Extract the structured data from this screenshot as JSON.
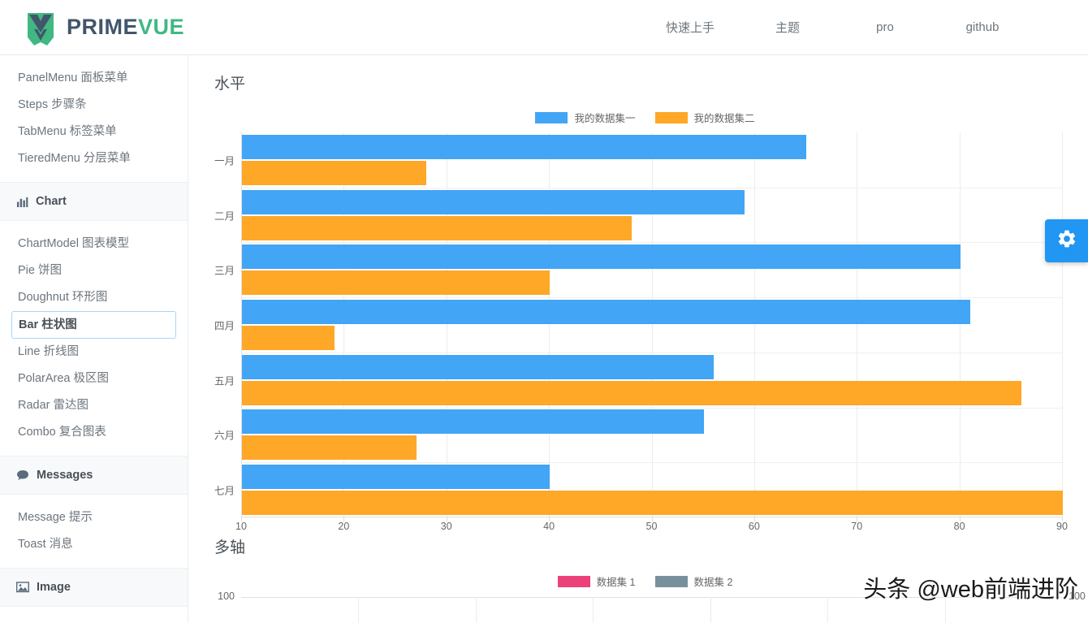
{
  "brand": {
    "prime": "PRIME",
    "vue": "VUE",
    "logo_icon": "primevue-shield-icon",
    "prime_color": "#41566c",
    "vue_color": "#41b883"
  },
  "topnav": [
    {
      "label": "快速上手"
    },
    {
      "label": "主题"
    },
    {
      "label": "pro"
    },
    {
      "label": "github"
    }
  ],
  "sidebar": {
    "groups": [
      {
        "type": "items",
        "items": [
          {
            "label": "PanelMenu 面板菜单",
            "active": false
          },
          {
            "label": "Steps 步骤条",
            "active": false
          },
          {
            "label": "TabMenu 标签菜单",
            "active": false
          },
          {
            "label": "TieredMenu 分层菜单",
            "active": false
          }
        ]
      },
      {
        "type": "header",
        "label": "Chart",
        "icon": "bar-chart-icon"
      },
      {
        "type": "items",
        "items": [
          {
            "label": "ChartModel 图表模型",
            "active": false
          },
          {
            "label": "Pie 饼图",
            "active": false
          },
          {
            "label": "Doughnut 环形图",
            "active": false
          },
          {
            "label": "Bar 柱状图",
            "active": true
          },
          {
            "label": "Line 折线图",
            "active": false
          },
          {
            "label": "PolarArea 极区图",
            "active": false
          },
          {
            "label": "Radar 雷达图",
            "active": false
          },
          {
            "label": "Combo 复合图表",
            "active": false
          }
        ]
      },
      {
        "type": "header",
        "label": "Messages",
        "icon": "comment-icon"
      },
      {
        "type": "items",
        "items": [
          {
            "label": "Message 提示",
            "active": false
          },
          {
            "label": "Toast 消息",
            "active": false
          }
        ]
      },
      {
        "type": "header",
        "label": "Image",
        "icon": "image-icon"
      }
    ],
    "scrollbar": {
      "up_arrow": "▲",
      "down_arrow": "▼"
    }
  },
  "settings_button": {
    "icon": "gear-icon",
    "color": "#2196F3"
  },
  "watermark": {
    "text": "头条 @web前端进阶"
  },
  "chart_data": [
    {
      "type": "bar",
      "orientation": "horizontal",
      "title": "水平",
      "categories": [
        "一月",
        "二月",
        "三月",
        "四月",
        "五月",
        "六月",
        "七月"
      ],
      "series": [
        {
          "name": "我的数据集一",
          "color": "#42A5F5",
          "values": [
            65,
            59,
            80,
            81,
            56,
            55,
            40
          ]
        },
        {
          "name": "我的数据集二",
          "color": "#FFA726",
          "values": [
            28,
            48,
            40,
            19,
            86,
            27,
            90
          ]
        }
      ],
      "xlabel": "",
      "ylabel": "",
      "xlim": [
        10,
        90
      ],
      "xticks": [
        10,
        20,
        30,
        40,
        50,
        60,
        70,
        80,
        90
      ],
      "grid": true,
      "legend_position": "top"
    },
    {
      "type": "bar",
      "title": "多轴",
      "series": [
        {
          "name": "数据集 1",
          "color": "#EC407A"
        },
        {
          "name": "数据集 2",
          "color": "#78909C"
        }
      ],
      "y_left_ticks": [
        "100"
      ],
      "y_right_ticks": [
        "100"
      ],
      "grid": true,
      "legend_position": "top"
    }
  ]
}
